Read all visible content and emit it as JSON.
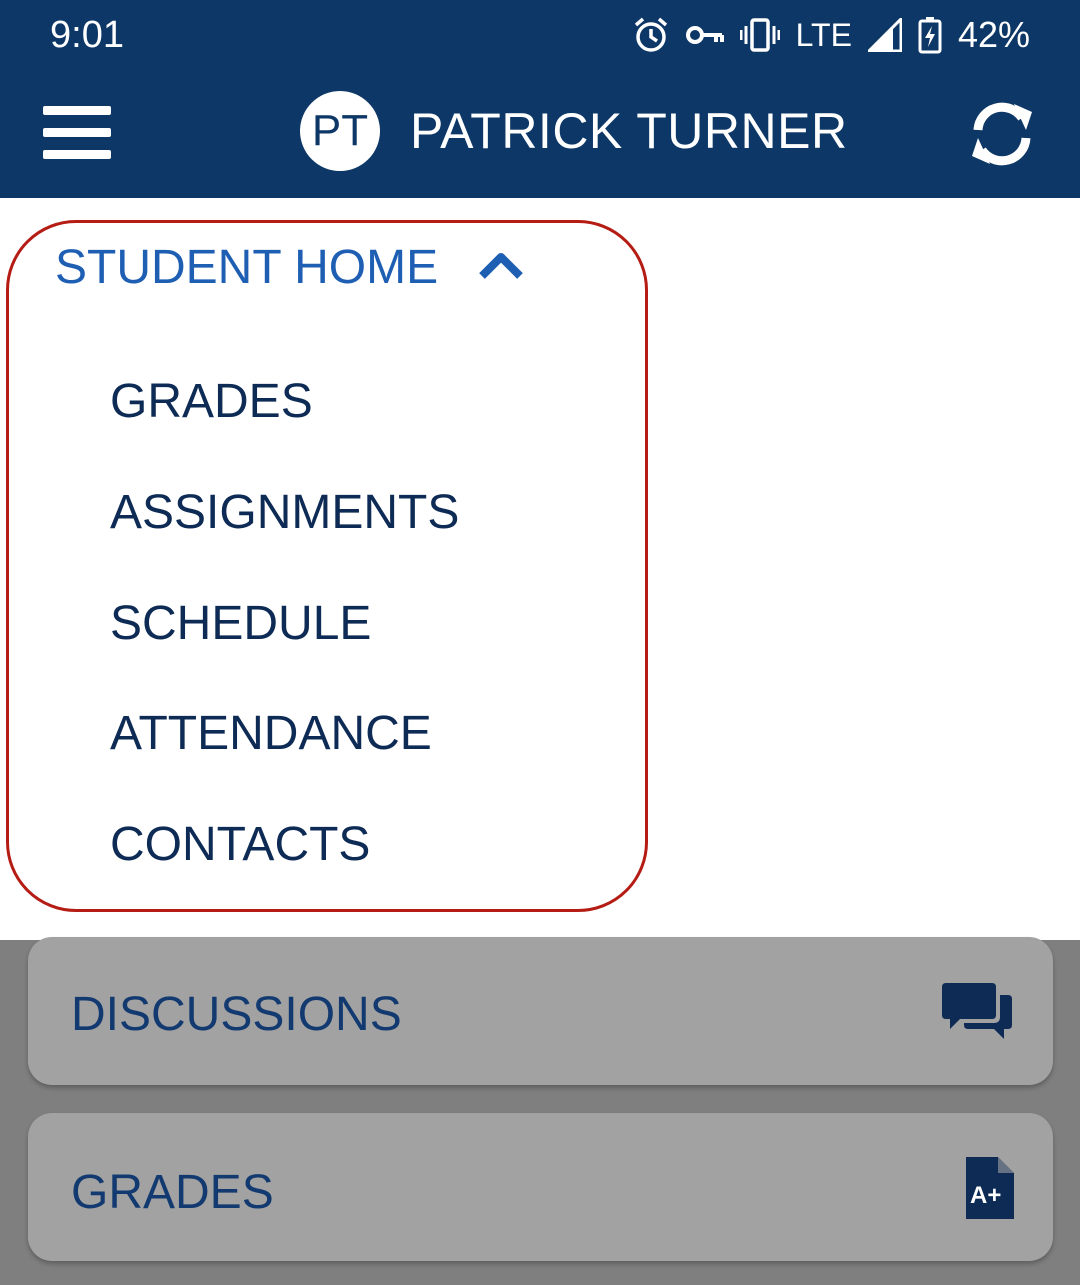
{
  "status_bar": {
    "time": "9:01",
    "network": "LTE",
    "battery": "42%",
    "icons": [
      "alarm-icon",
      "vpn-key-icon",
      "vibrate-icon",
      "signal-icon",
      "battery-charging-icon"
    ]
  },
  "header": {
    "avatar_initials": "PT",
    "user_name": "PATRICK TURNER",
    "icons": [
      "hamburger-menu-icon",
      "refresh-icon"
    ],
    "background_color": "#0d3766"
  },
  "dropdown": {
    "section_title": "STUDENT HOME",
    "items": [
      {
        "label": "GRADES"
      },
      {
        "label": "ASSIGNMENTS"
      },
      {
        "label": "SCHEDULE"
      },
      {
        "label": "ATTENDANCE"
      },
      {
        "label": "CONTACTS"
      }
    ],
    "outline_color": "#b41c14",
    "title_color": "#1f5fb3"
  },
  "cards": [
    {
      "label": "DISCUSSIONS",
      "icon": "chat-bubbles-icon"
    },
    {
      "label": "GRADES",
      "icon": "grade-document-icon"
    }
  ]
}
